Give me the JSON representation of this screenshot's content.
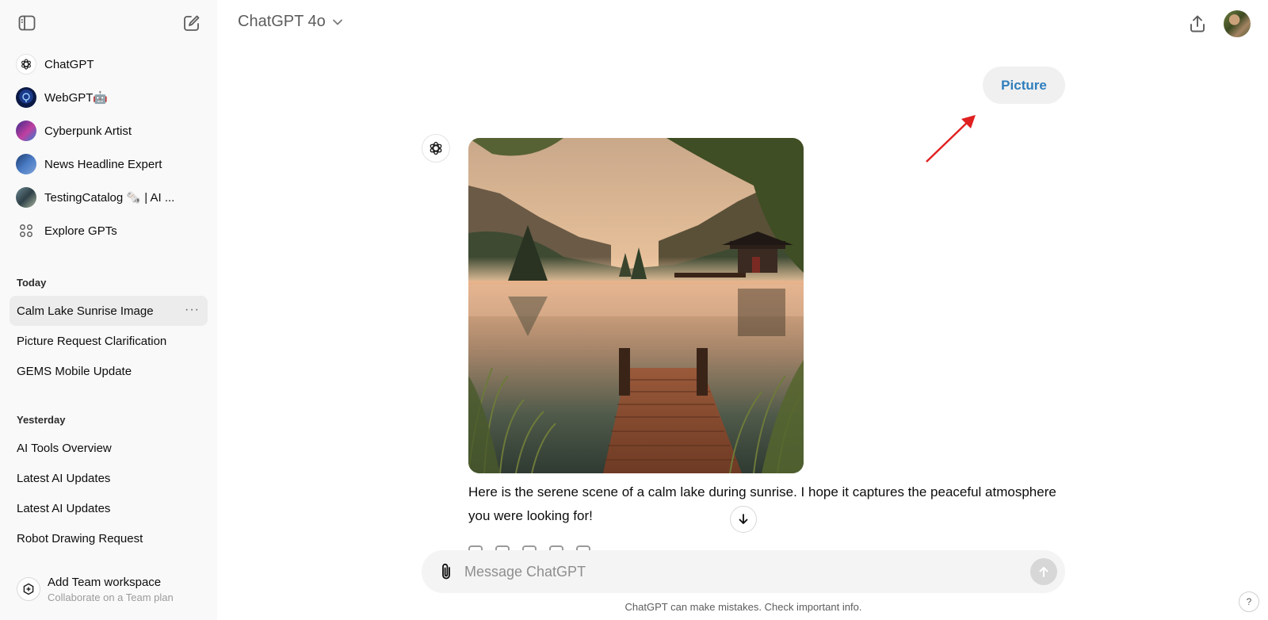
{
  "sidebar": {
    "gpts": [
      {
        "label": "ChatGPT",
        "icon": "chatgpt-logo-icon"
      },
      {
        "label": "WebGPT🤖",
        "icon": "webgpt-avatar"
      },
      {
        "label": "Cyberpunk Artist",
        "icon": "cyberpunk-avatar"
      },
      {
        "label": "News Headline Expert",
        "icon": "news-avatar"
      },
      {
        "label": "TestingCatalog 🗞️ | AI ...",
        "icon": "testingcatalog-avatar"
      },
      {
        "label": "Explore GPTs",
        "icon": "grid-icon"
      }
    ],
    "sections": [
      {
        "label": "Today",
        "items": [
          "Calm Lake Sunrise Image",
          "Picture Request Clarification",
          "GEMS Mobile Update"
        ]
      },
      {
        "label": "Yesterday",
        "items": [
          "AI Tools Overview",
          "Latest AI Updates",
          "Latest AI Updates",
          "Robot Drawing Request"
        ]
      }
    ],
    "more_label": "···",
    "team": {
      "title": "Add Team workspace",
      "subtitle": "Collaborate on a Team plan"
    }
  },
  "header": {
    "model": "ChatGPT 4o"
  },
  "conversation": {
    "user_message": "Picture",
    "assistant_text": "Here is the serene scene of a calm lake during sunrise. I hope it captures the peaceful atmosphere you were looking for!"
  },
  "composer": {
    "placeholder": "Message ChatGPT",
    "value": ""
  },
  "disclaimer": "ChatGPT can make mistakes. Check important info.",
  "help_label": "?",
  "colors": {
    "sidebar_bg": "#f9f9f9",
    "accent_text": "#2f7ebd",
    "annotation_arrow": "#e02020"
  }
}
